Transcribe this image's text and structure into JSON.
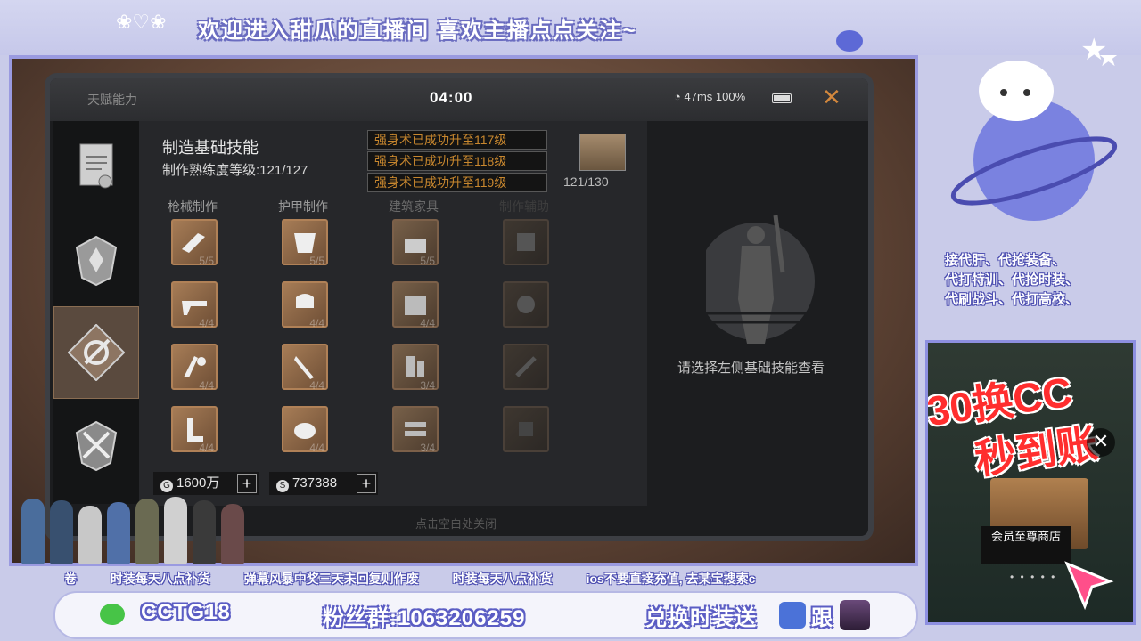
{
  "overlay": {
    "top_banner": "欢迎进入甜瓜的直播间 喜欢主播点点关注~",
    "service_text": [
      "接代肝、代抢装备、",
      "代打特训、代抢时装、",
      "代刷战斗、代打高校、"
    ],
    "promo": {
      "line1": "30换CC",
      "line2": "秒到账",
      "store_label": "会员至尊商店"
    },
    "ticker": [
      "卷",
      "时装每天八点补货",
      "弹幕风暴中奖三天未回复则作废",
      "时装每天八点补货",
      "ios不要直接充值, 去某宝搜索c"
    ],
    "wechat_id": "CCTG18",
    "fan_group": "粉丝群:1063206259",
    "exchange_text": "兑换时装送",
    "follow_text": "跟"
  },
  "game": {
    "header": {
      "talent_label": "天赋能力",
      "clock": "04:00",
      "wifi_latency": "47ms",
      "battery": "100%"
    },
    "panel": {
      "title": "制造基础技能",
      "proficiency": "制作熟练度等级:121/127",
      "notifications": [
        "强身术已成功升至117级",
        "强身术已成功升至118级",
        "强身术已成功升至119级"
      ],
      "portrait_count": "121/130",
      "columns": [
        "枪械制作",
        "护甲制作",
        "建筑家具",
        "制作辅助"
      ],
      "skills": [
        [
          "5/5",
          "5/5",
          "5/5",
          ""
        ],
        [
          "4/4",
          "4/4",
          "4/4",
          ""
        ],
        [
          "4/4",
          "4/4",
          "3/4",
          ""
        ],
        [
          "4/4",
          "4/4",
          "3/4",
          ""
        ]
      ],
      "currency": [
        {
          "icon": "G",
          "value": "1600万"
        },
        {
          "icon": "S",
          "value": "737388"
        }
      ]
    },
    "hint": "请选择左侧基础技能查看",
    "close_hint": "点击空白处关闭"
  }
}
